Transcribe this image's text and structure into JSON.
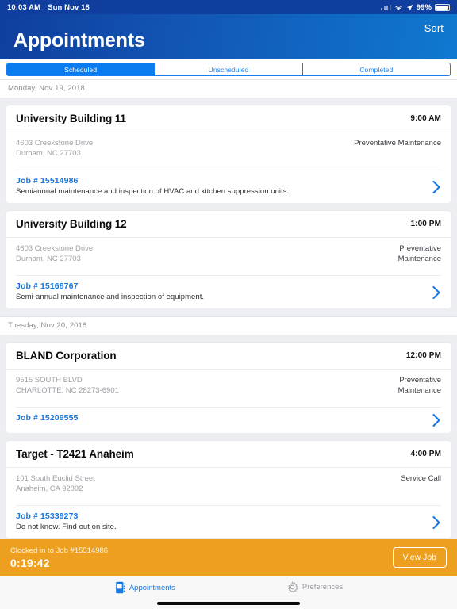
{
  "statusbar": {
    "time": "10:03 AM",
    "date": "Sun Nov 18",
    "battery_percent": "99%",
    "icons": [
      "signal-dots-icon",
      "wifi-icon",
      "location-arrow-icon",
      "battery-icon"
    ]
  },
  "header": {
    "title": "Appointments",
    "sort_label": "Sort",
    "gradient_start": "#0f3e9e",
    "gradient_end": "#0f79d0"
  },
  "segmented": {
    "accent": "#0a7cf0",
    "options": [
      {
        "label": "Scheduled",
        "active": true
      },
      {
        "label": "Unscheduled",
        "active": false
      },
      {
        "label": "Completed",
        "active": false
      }
    ]
  },
  "groups": [
    {
      "date_label": "Monday, Nov 19, 2018",
      "appointments": [
        {
          "name": "University Building 11",
          "time": "9:00 AM",
          "address_line1": "4603 Creekstone Drive",
          "address_line2": "Durham, NC 27703",
          "job_type": "Preventative Maintenance",
          "job_type_wide": true,
          "job_number": "Job # 15514986",
          "description": "Semiannual maintenance and inspection of HVAC and kitchen suppression units."
        },
        {
          "name": "University Building 12",
          "time": "1:00 PM",
          "address_line1": "4603 Creekstone Drive",
          "address_line2": "Durham, NC 27703",
          "job_type": "Preventative Maintenance",
          "job_type_wide": false,
          "job_number": "Job # 15168767",
          "description": "Semi-annual maintenance and inspection of equipment."
        }
      ]
    },
    {
      "date_label": "Tuesday, Nov 20, 2018",
      "appointments": [
        {
          "name": "BLAND Corporation",
          "time": "12:00 PM",
          "address_line1": "9515 SOUTH BLVD",
          "address_line2": "CHARLOTTE, NC 28273-6901",
          "job_type": "Preventative Maintenance",
          "job_type_wide": false,
          "job_number": "Job # 15209555",
          "description": ""
        },
        {
          "name": "Target - T2421 Anaheim",
          "time": "4:00 PM",
          "address_line1": "101 South Euclid Street",
          "address_line2": "Anaheim, CA 92802",
          "job_type": "Service Call",
          "job_type_wide": true,
          "job_number": "Job # 15339273",
          "description": "Do not know.  Find out on site."
        }
      ]
    }
  ],
  "clockbar": {
    "status_text": "Clocked in to Job #15514986",
    "elapsed": "0:19:42",
    "view_job_label": "View Job",
    "background": "#eda020"
  },
  "tabbar": {
    "tabs": [
      {
        "label": "Appointments",
        "icon": "notebook-icon",
        "active": true
      },
      {
        "label": "Preferences",
        "icon": "gear-icon",
        "active": false
      }
    ]
  }
}
